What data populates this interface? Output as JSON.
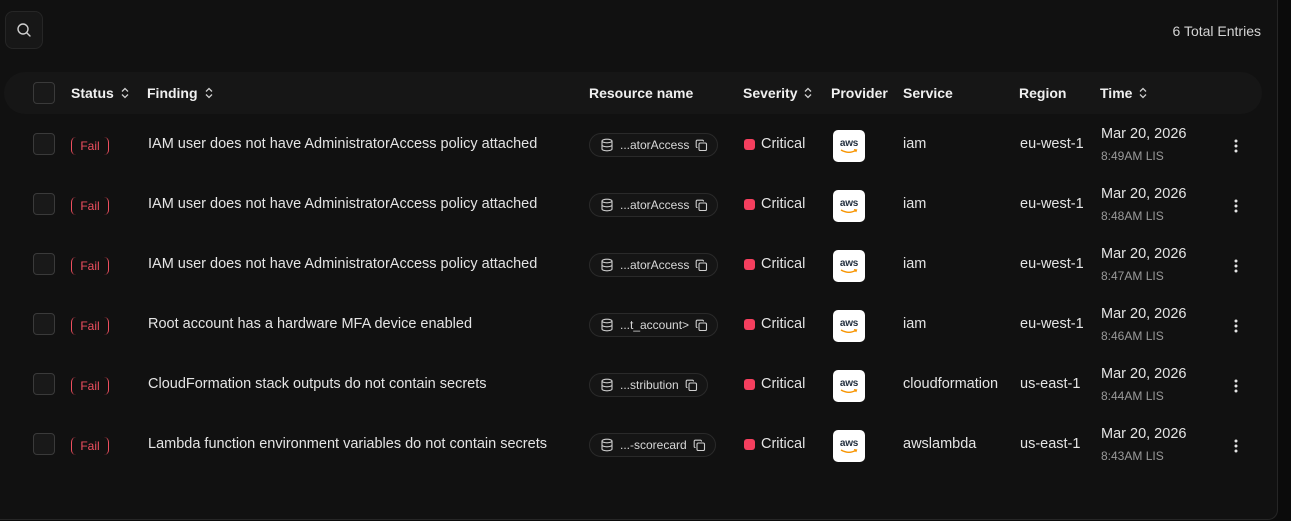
{
  "toolbar": {
    "search_icon": "search-icon",
    "total_entries": "6 Total Entries"
  },
  "columns": {
    "status": "Status",
    "finding": "Finding",
    "resource_name": "Resource name",
    "severity": "Severity",
    "provider": "Provider",
    "service": "Service",
    "region": "Region",
    "time": "Time"
  },
  "colors": {
    "fail": "#ef4f5f",
    "critical": "#f43f5e",
    "background": "#111111"
  },
  "provider_logo_text": "aws",
  "rows": [
    {
      "status": "Fail",
      "finding": "IAM user does not have AdministratorAccess policy attached",
      "resource": "...atorAccess",
      "severity": "Critical",
      "service": "iam",
      "region": "eu-west-1",
      "date": "Mar 20, 2026",
      "time": "8:49AM LIS"
    },
    {
      "status": "Fail",
      "finding": "IAM user does not have AdministratorAccess policy attached",
      "resource": "...atorAccess",
      "severity": "Critical",
      "service": "iam",
      "region": "eu-west-1",
      "date": "Mar 20, 2026",
      "time": "8:48AM LIS"
    },
    {
      "status": "Fail",
      "finding": "IAM user does not have AdministratorAccess policy attached",
      "resource": "...atorAccess",
      "severity": "Critical",
      "service": "iam",
      "region": "eu-west-1",
      "date": "Mar 20, 2026",
      "time": "8:47AM LIS"
    },
    {
      "status": "Fail",
      "finding": "Root account has a hardware MFA device enabled",
      "resource": "...t_account>",
      "severity": "Critical",
      "service": "iam",
      "region": "eu-west-1",
      "date": "Mar 20, 2026",
      "time": "8:46AM LIS"
    },
    {
      "status": "Fail",
      "finding": "CloudFormation stack outputs do not contain secrets",
      "resource": "...stribution",
      "severity": "Critical",
      "service": "cloudformation",
      "region": "us-east-1",
      "date": "Mar 20, 2026",
      "time": "8:44AM LIS"
    },
    {
      "status": "Fail",
      "finding": "Lambda function environment variables do not contain secrets",
      "resource": "...-scorecard",
      "severity": "Critical",
      "service": "awslambda",
      "region": "us-east-1",
      "date": "Mar 20, 2026",
      "time": "8:43AM LIS"
    }
  ]
}
